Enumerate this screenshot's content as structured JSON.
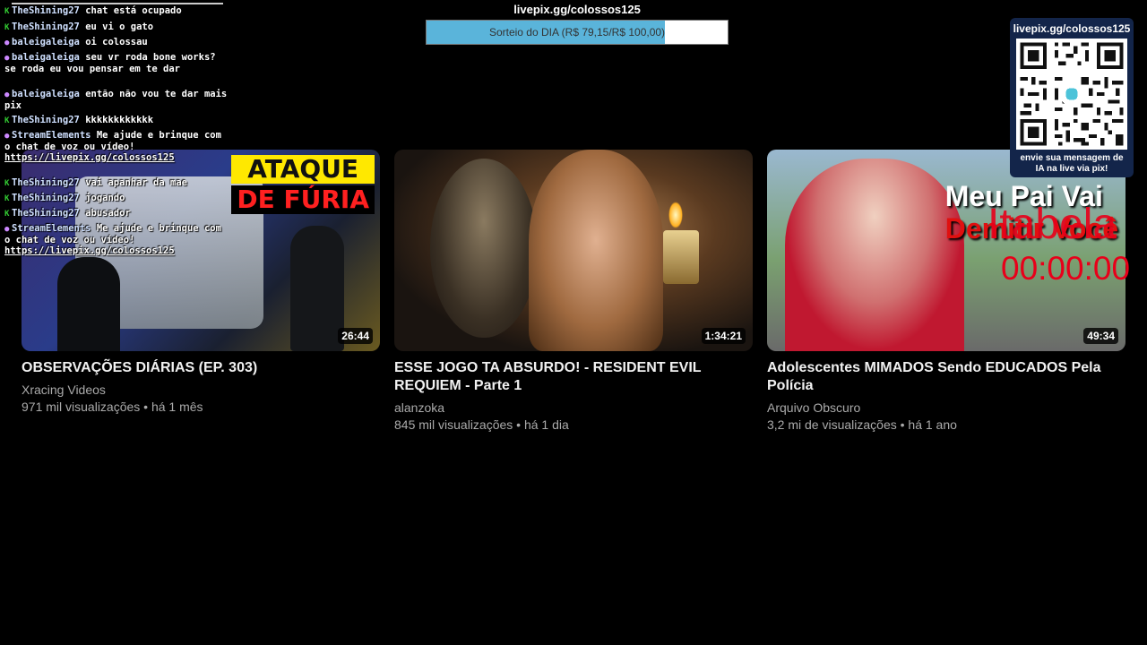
{
  "colors": {
    "progress_fill": "#5ab4da",
    "timer_red": "#e8001a",
    "qr_panel": "#13254a"
  },
  "donation": {
    "url": "livepix.gg/colossos125",
    "label": "Sorteio do DIA (R$ 79,15/R$ 100,00)",
    "current": 79.15,
    "goal": 100.0,
    "fraction": 0.7915
  },
  "qr": {
    "url": "livepix.gg/colossos125",
    "caption_line1": "envie sua mensagem de",
    "caption_line2": "IA na live via pix!",
    "icon": "qr-code-icon"
  },
  "timer": {
    "name": "Itabela",
    "time": "00:00:00"
  },
  "chat": [
    {
      "badge": "green-k-icon",
      "user": "TheShining27",
      "text": "chat está ocupado"
    },
    {
      "badge": "green-k-icon",
      "user": "TheShining27",
      "text": "eu vi o gato"
    },
    {
      "badge": "purple-chat-icon",
      "user": "baleigaleiga",
      "text": "oi colossau"
    },
    {
      "badge": "purple-chat-icon",
      "user": "baleigaleiga",
      "text": "seu vr roda bone works? se roda eu vou pensar em te dar"
    },
    {
      "badge": "purple-chat-icon",
      "user": "baleigaleiga",
      "text": "então não vou te dar mais pix"
    },
    {
      "badge": "green-k-icon",
      "user": "TheShining27",
      "text": "kkkkkkkkkkkk"
    },
    {
      "badge": "purple-chat-icon",
      "user": "StreamElements",
      "text": "Me ajude e brinque com o chat de voz ou vídeo!",
      "link": "https://livepix.gg/colossos125"
    },
    {
      "badge": "green-k-icon",
      "user": "TheShining27",
      "text": "vai apanhar da mae"
    },
    {
      "badge": "green-k-icon",
      "user": "TheShining27",
      "text": "jogando"
    },
    {
      "badge": "green-k-icon",
      "user": "TheShining27",
      "text": "abusador"
    },
    {
      "badge": "purple-chat-icon",
      "user": "StreamElements",
      "text": "Me ajude e brinque com o chat de voz ou vídeo!",
      "link": "https://livepix.gg/colossos125"
    }
  ],
  "videos": [
    {
      "title": "OBSERVAÇÕES DIÁRIAS (EP. 303)",
      "channel": "Xracing Videos",
      "meta": "971 mil visualizações • há 1 mês",
      "duration": "26:44",
      "overlay_line1": "ATAQUE",
      "overlay_line2": "DE FÚRIA"
    },
    {
      "title": "ESSE JOGO TA ABSURDO! - RESIDENT EVIL REQUIEM - Parte 1",
      "channel": "alanzoka",
      "meta": "845 mil visualizações • há 1 dia",
      "duration": "1:34:21"
    },
    {
      "title": "Adolescentes MIMADOS Sendo EDUCADOS Pela Polícia",
      "channel": "Arquivo Obscuro",
      "meta": "3,2 mi de visualizações • há 1 ano",
      "duration": "49:34",
      "overlay_line1": "Meu Pai Vai",
      "overlay_line2": "Demitir Você"
    }
  ]
}
